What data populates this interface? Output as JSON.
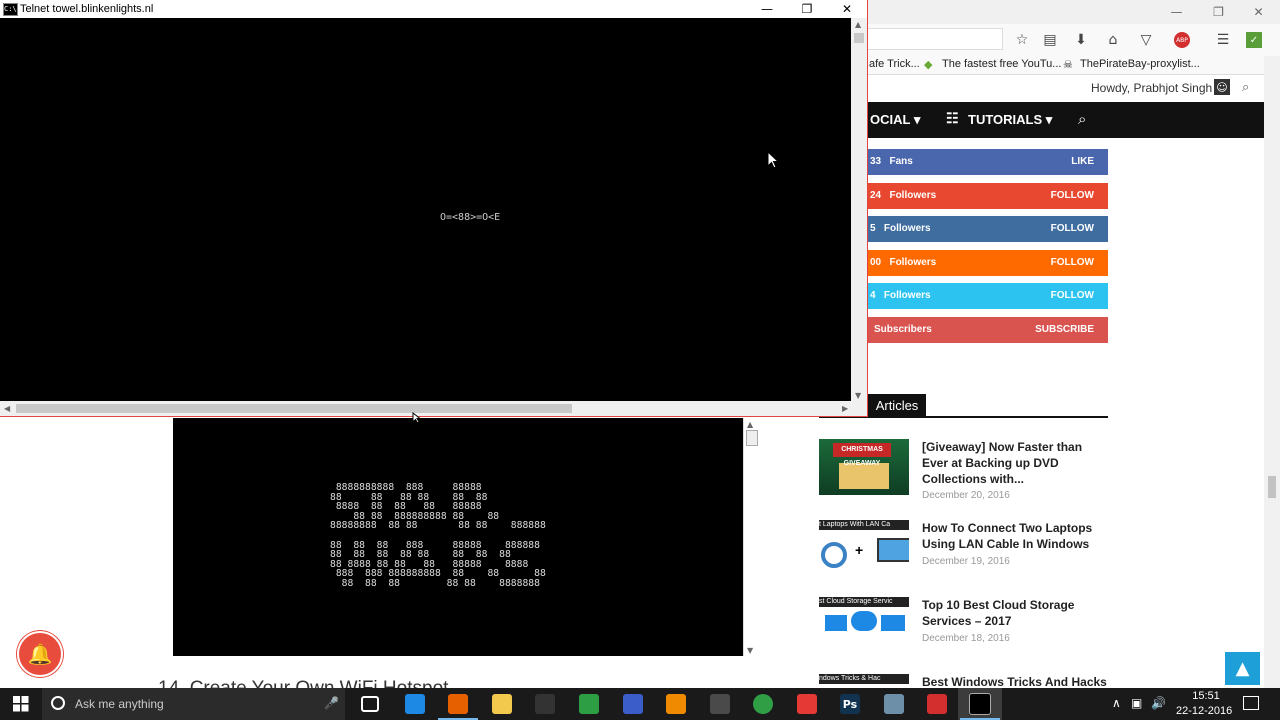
{
  "browser": {
    "bookmarks": [
      "afe Trick...",
      "The fastest free YouTu...",
      "ThePirateBay-proxylist..."
    ],
    "greeting": "Howdy, Prabhjot Singh",
    "nav": {
      "social": "OCIAL",
      "tutorials": "TUTORIALS"
    },
    "social_counters": [
      {
        "count": "33",
        "unit": "Fans",
        "action": "LIKE",
        "color": "#4a66ac"
      },
      {
        "count": "24",
        "unit": "Followers",
        "action": "FOLLOW",
        "color": "#e8482f"
      },
      {
        "count": "5",
        "unit": "Followers",
        "action": "FOLLOW",
        "color": "#3f6da0"
      },
      {
        "count": "00",
        "unit": "Followers",
        "action": "FOLLOW",
        "color": "#ff6a00"
      },
      {
        "count": "4",
        "unit": "Followers",
        "action": "FOLLOW",
        "color": "#2cc3f0"
      },
      {
        "count": "",
        "unit": "Subscribers",
        "action": "SUBSCRIBE",
        "color": "#d9534f"
      }
    ],
    "articles_tab": "Articles",
    "articles": [
      {
        "title": "[Giveaway] Now Faster than Ever at Backing up DVD Collections with...",
        "date": "December 20, 2016",
        "thumb_text": "CHRISTMAS GIVEAWAY"
      },
      {
        "title": "How To Connect Two Laptops Using LAN Cable In Windows",
        "date": "December 19, 2016",
        "thumb_text": "t Laptops With LAN Ca"
      },
      {
        "title": "Top 10 Best Cloud Storage Services – 2017",
        "date": "December 18, 2016",
        "thumb_text": "st Cloud Storage Servic"
      },
      {
        "title": "Best Windows Tricks And Hacks",
        "date": "",
        "thumb_text": "ndows Tricks & Hac"
      }
    ],
    "video_ascii": " 8888888888  888     88888\n88     88   88 88    88  88\n 8888  88  88   88   88888\n    88 88  888888888 88    88\n88888888  88 88       88 88    888888\n\n88  88  88   888     88888    888888\n88  88  88  88 88    88  88  88\n88 8888 88 88   88   88888    8888\n 888  888 888888888  88    88      88\n  88  88  88        88 88    8888888",
    "heading_partial": "14. Create Your Own WiFi Hotspot"
  },
  "telnet": {
    "title": "Telnet towel.blinkenlights.nl",
    "ascii_line": "O=<88>=O<E"
  },
  "taskbar": {
    "search_placeholder": "Ask me anything",
    "time": "15:51",
    "date": "22-12-2016",
    "apps": [
      {
        "name": "task-view",
        "label": "",
        "color": "#1a1a1a"
      },
      {
        "name": "app-blue",
        "label": "",
        "color": "#1e88e5"
      },
      {
        "name": "firefox",
        "label": "",
        "color": "#e66000"
      },
      {
        "name": "file-explorer",
        "label": "",
        "color": "#f2c94c"
      },
      {
        "name": "store",
        "label": "",
        "color": "#333333"
      },
      {
        "name": "camtasia",
        "label": "",
        "color": "#2e9e44"
      },
      {
        "name": "visual-studio",
        "label": "",
        "color": "#3b5dc9"
      },
      {
        "name": "vlc",
        "label": "",
        "color": "#f08a00"
      },
      {
        "name": "media-app",
        "label": "",
        "color": "#4a4a4a"
      },
      {
        "name": "chrome",
        "label": "",
        "color": "#2f9e44"
      },
      {
        "name": "app-red",
        "label": "",
        "color": "#e53935"
      },
      {
        "name": "photoshop",
        "label": "Ps",
        "color": "#12334f"
      },
      {
        "name": "app-gallery",
        "label": "",
        "color": "#6d8fa8"
      },
      {
        "name": "app-orange",
        "label": "",
        "color": "#d32f2f"
      },
      {
        "name": "command-prompt",
        "label": "",
        "color": "#000000"
      }
    ]
  }
}
